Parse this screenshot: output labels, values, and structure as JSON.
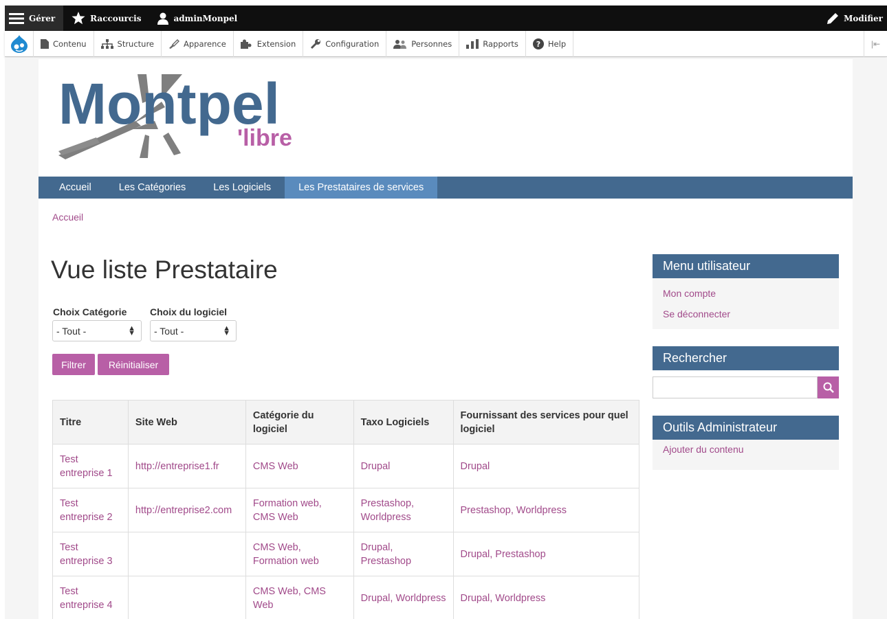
{
  "toolbar": {
    "manage": "Gérer",
    "shortcuts": "Raccourcis",
    "user": "adminMonpel",
    "edit": "Modifier"
  },
  "tray": {
    "items": [
      "Contenu",
      "Structure",
      "Apparence",
      "Extension",
      "Configuration",
      "Personnes",
      "Rapports",
      "Help"
    ]
  },
  "site": {
    "logo_main": "Montpel",
    "logo_sub": "'libre",
    "colors": {
      "nav": "#43698f",
      "nav_active": "#5a8bbd",
      "accent": "#b85fa6",
      "link": "#a14a8a"
    }
  },
  "nav": {
    "items": [
      "Accueil",
      "Les Catégories",
      "Les Logiciels",
      "Les Prestataires de services"
    ],
    "active": "Les Prestataires de services"
  },
  "breadcrumb": "Accueil",
  "page_title": "Vue liste Prestataire",
  "filters": {
    "category_label": "Choix Catégorie",
    "category_value": "- Tout -",
    "software_label": "Choix du logiciel",
    "software_value": "- Tout -",
    "filter_button": "Filtrer",
    "reset_button": "Réinitialiser"
  },
  "table": {
    "headers": [
      "Titre",
      "Site Web",
      "Catégorie du logiciel",
      "Taxo Logiciels",
      "Fournissant des services pour quel logiciel"
    ],
    "rows": [
      [
        "Test entreprise 1",
        "http://entreprise1.fr",
        "CMS Web",
        "Drupal",
        "Drupal"
      ],
      [
        "Test entreprise 2",
        "http://entreprise2.com",
        "Formation web, CMS Web",
        "Prestashop, Worldpress",
        "Prestashop, Worldpress"
      ],
      [
        "Test entreprise 3",
        "",
        "CMS Web, Formation web",
        "Drupal, Prestashop",
        "Drupal, Prestashop"
      ],
      [
        "Test entreprise 4",
        "",
        "CMS Web, CMS Web",
        "Drupal, Worldpress",
        "Drupal, Worldpress"
      ]
    ]
  },
  "sidebar": {
    "user_menu": {
      "title": "Menu utilisateur",
      "links": [
        "Mon compte",
        "Se déconnecter"
      ]
    },
    "search": {
      "title": "Rechercher"
    },
    "admin_tools": {
      "title": "Outils Administrateur",
      "links": [
        "Ajouter du contenu"
      ]
    }
  }
}
